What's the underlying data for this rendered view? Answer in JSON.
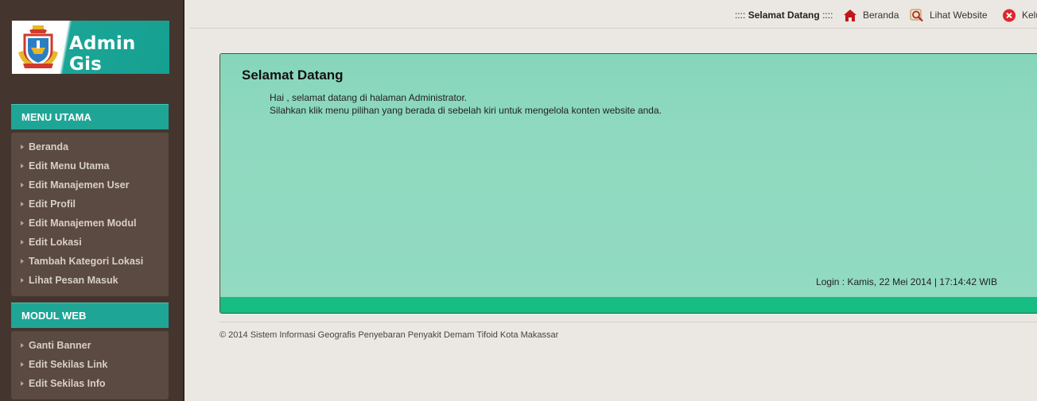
{
  "brand": {
    "title": "Admin Gis"
  },
  "sidebar": {
    "menu_utama": {
      "header": "MENU UTAMA",
      "items": [
        "Beranda",
        "Edit Menu Utama",
        "Edit Manajemen User",
        "Edit Profil",
        "Edit Manajemen Modul",
        "Edit Lokasi",
        "Tambah Kategori Lokasi",
        "Lihat Pesan Masuk"
      ]
    },
    "modul_web": {
      "header": "MODUL WEB",
      "items": [
        "Ganti Banner",
        "Edit Sekilas Link",
        "Edit Sekilas Info"
      ]
    }
  },
  "topbar": {
    "welcome_prefix": "::::",
    "welcome": "Selamat Datang",
    "welcome_suffix": "::::",
    "beranda": "Beranda",
    "lihat_website": "Lihat Website",
    "keluar": "Keluar"
  },
  "panel": {
    "title": "Selamat Datang",
    "line1": "Hai , selamat datang di halaman Administrator.",
    "line2": "Silahkan klik menu pilihan yang berada di sebelah kiri untuk mengelola konten website anda.",
    "login": "Login : Kamis, 22 Mei 2014 | 17:14:42 WIB"
  },
  "footer": {
    "text": "© 2014 Sistem Informasi Geografis Penyebaran Penyakit Demam Tifoid Kota Makassar"
  },
  "colors": {
    "accent": "#1fa596",
    "sidebar": "#44362e",
    "panel": "#8fd9c0",
    "panel_bar": "#17bd82"
  }
}
